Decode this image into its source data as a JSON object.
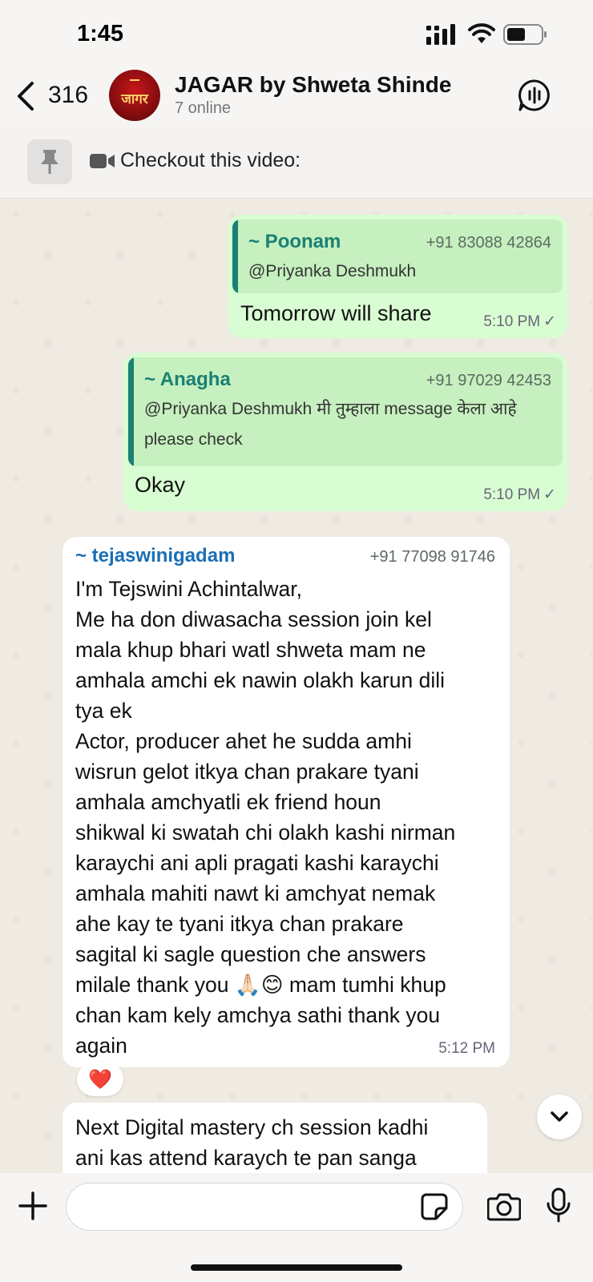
{
  "status_bar": {
    "time": "1:45"
  },
  "header": {
    "back_count": "316",
    "avatar_text": "जागर",
    "group_name": "JAGAR by Shweta Shinde",
    "subtitle": "7 online"
  },
  "pinned": {
    "text": "Checkout this video:"
  },
  "messages": [
    {
      "quote": {
        "name": "~ Poonam",
        "phone": "+91 83088 42864",
        "text": "@Priyanka Deshmukh"
      },
      "text": "Tomorrow will share",
      "time": "5:10 PM",
      "tick": "✓"
    },
    {
      "quote": {
        "name": "~ Anagha",
        "phone": "+91 97029 42453",
        "text_line1": "@Priyanka Deshmukh मी तुम्हाला message केला आहे",
        "text_line2": "please check"
      },
      "text": "Okay",
      "time": "5:10 PM",
      "tick": "✓"
    },
    {
      "sender": "~ tejaswinigadam",
      "phone": "+91 77098 91746",
      "lines": [
        "I'm Tejswini Achintalwar,",
        "Me ha don diwasacha session join kel",
        "mala khup bhari watl shweta mam ne",
        "amhala amchi ek nawin olakh karun dili",
        "tya ek",
        "Actor, producer ahet he sudda amhi",
        "wisrun gelot itkya chan prakare tyani",
        "amhala amchyatli ek friend houn",
        "shikwal ki swatah chi olakh kashi nirman",
        "karaychi ani apli pragati kashi karaychi",
        "amhala mahiti nawt ki amchyat nemak",
        "ahe kay te tyani itkya chan prakare",
        "sagital ki sagle question che answers",
        "milale thank you 🙏🏻😊 mam tumhi khup",
        "chan kam kely amchya sathi thank you",
        "again"
      ],
      "time": "5:12 PM",
      "reaction": "❤️"
    },
    {
      "lines": [
        "Next Digital mastery ch session kadhi",
        "ani kas attend karaych te pan sanga"
      ]
    }
  ],
  "composer": {
    "placeholder": ""
  },
  "colors": {
    "outgoing_bubble": "#d9fdd3",
    "incoming_bubble": "#ffffff",
    "accent_teal": "#1a8074",
    "accent_blue": "#1b6fb5"
  },
  "icons": [
    "back-chevron-icon",
    "signal-icon",
    "wifi-icon",
    "battery-icon",
    "voice-chat-icon",
    "pin-icon",
    "video-icon",
    "chevron-down-icon",
    "plus-icon",
    "sticker-icon",
    "camera-icon",
    "microphone-icon"
  ]
}
